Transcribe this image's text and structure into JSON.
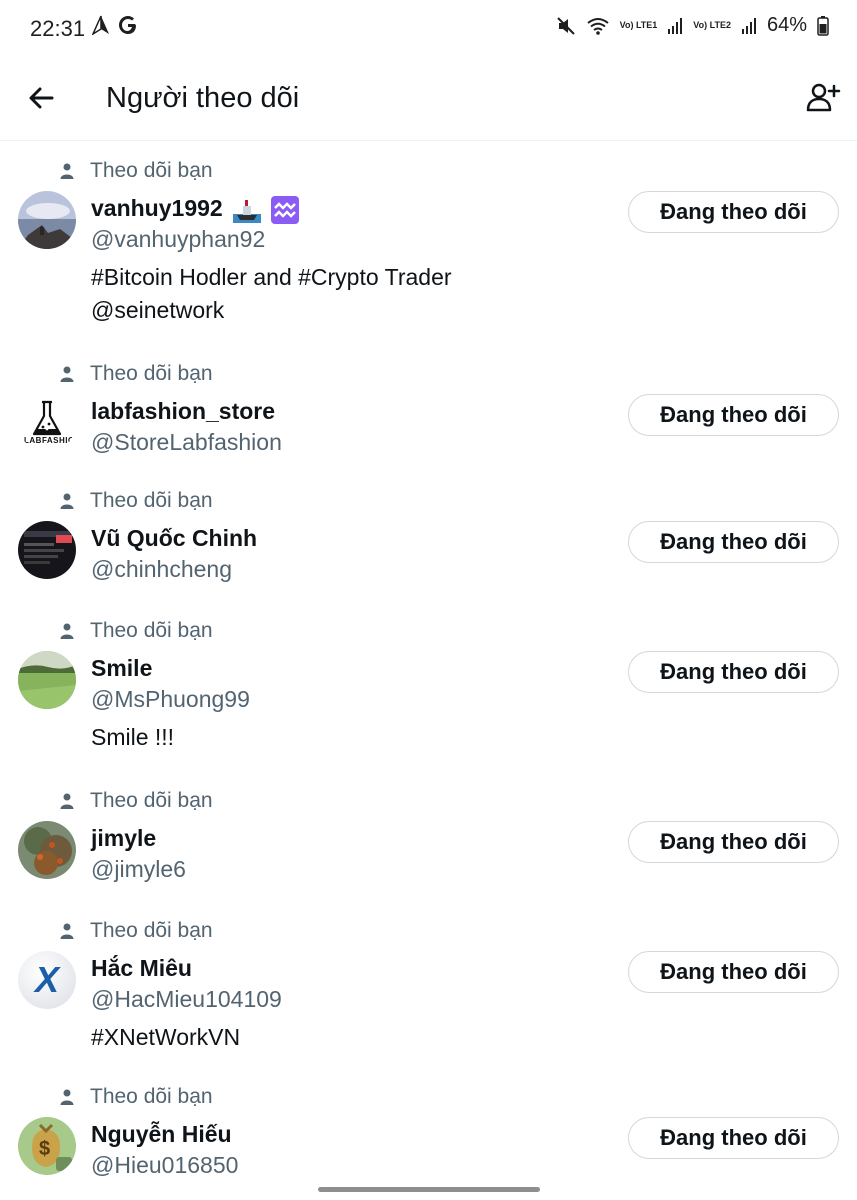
{
  "status_bar": {
    "time": "22:31",
    "left_icons": [
      "navigation-icon",
      "google-icon"
    ],
    "right_icons": [
      "mute-icon",
      "wifi-icon",
      "lte1-signal-icon",
      "lte2-signal-icon",
      "battery-icon"
    ],
    "lte1_label": "Vo) LTE1",
    "lte2_label": "Vo) LTE2",
    "battery": "64%"
  },
  "header": {
    "title": "Người theo dõi",
    "back_icon": "arrow-left-icon",
    "add_icon": "add-user-icon"
  },
  "followers": [
    {
      "follows_you": "Theo dõi bạn",
      "name": "vanhuy1992",
      "badges": [
        "ship-emoji",
        "aquarius-emoji"
      ],
      "handle": "@vanhuyphan92",
      "bio": [
        "#Bitcoin Hodler and #Crypto Trader",
        "@seinetwork"
      ],
      "button": "Đang theo dõi",
      "avatar_color": "#9aa7c0"
    },
    {
      "follows_you": "Theo dõi bạn",
      "name": "labfashion_store",
      "badges": [],
      "handle": "@StoreLabfashion",
      "bio": [],
      "button": "Đang theo dõi",
      "avatar_text": "LABFASHION"
    },
    {
      "follows_you": "Theo dõi bạn",
      "name": "Vũ Quốc Chinh",
      "badges": [],
      "handle": "@chinhcheng",
      "bio": [],
      "button": "Đang theo dõi",
      "avatar_color": "#1c1c22"
    },
    {
      "follows_you": "Theo dõi bạn",
      "name": "Smile",
      "badges": [],
      "handle": "@MsPhuong99",
      "bio": [
        "Smile !!!"
      ],
      "button": "Đang theo dõi",
      "avatar_color": "#7fa65a"
    },
    {
      "follows_you": "Theo dõi bạn",
      "name": "jimyle",
      "badges": [],
      "handle": "@jimyle6",
      "bio": [],
      "button": "Đang theo dõi",
      "avatar_color": "#6b5a45"
    },
    {
      "follows_you": "Theo dõi bạn",
      "name": "Hắc Miêu",
      "badges": [],
      "handle": "@HacMieu104109",
      "bio": [
        "#XNetWorkVN"
      ],
      "button": "Đang theo dõi",
      "avatar_text": "X"
    },
    {
      "follows_you": "Theo dõi bạn",
      "name": "Nguyễn Hiếu",
      "badges": [],
      "handle": "@Hieu016850",
      "bio": [],
      "button": "Đang theo dõi",
      "avatar_color": "#c9a24a"
    }
  ]
}
